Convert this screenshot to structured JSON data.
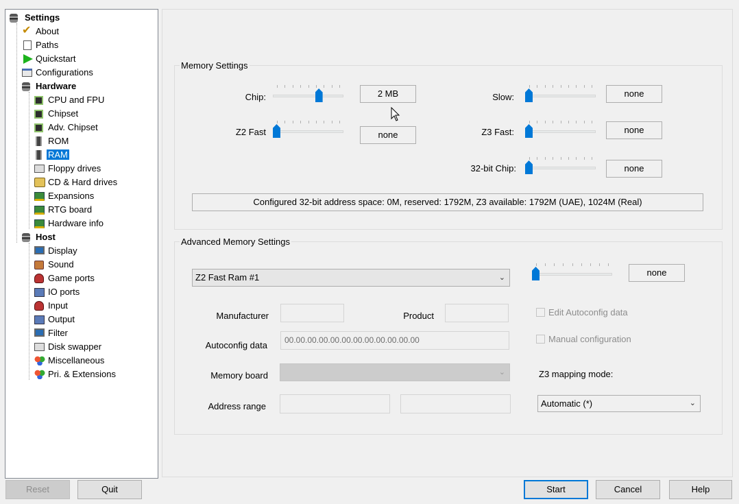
{
  "tree": {
    "settings": "Settings",
    "items": [
      {
        "label": "About",
        "icon": "checkmark-icon"
      },
      {
        "label": "Paths",
        "icon": "document-icon"
      },
      {
        "label": "Quickstart",
        "icon": "play-icon"
      },
      {
        "label": "Configurations",
        "icon": "configuration-icon"
      }
    ],
    "hardware": "Hardware",
    "hardware_items": [
      {
        "label": "CPU and FPU",
        "icon": "cpu-chip-icon"
      },
      {
        "label": "Chipset",
        "icon": "chip-icon"
      },
      {
        "label": "Adv. Chipset",
        "icon": "chip-icon"
      },
      {
        "label": "ROM",
        "icon": "rom-icon"
      },
      {
        "label": "RAM",
        "icon": "ram-icon",
        "selected": true
      },
      {
        "label": "Floppy drives",
        "icon": "floppy-icon"
      },
      {
        "label": "CD & Hard drives",
        "icon": "harddrive-icon"
      },
      {
        "label": "Expansions",
        "icon": "expansion-card-icon"
      },
      {
        "label": "RTG board",
        "icon": "graphics-card-icon"
      },
      {
        "label": "Hardware info",
        "icon": "info-card-icon"
      }
    ],
    "host": "Host",
    "host_items": [
      {
        "label": "Display",
        "icon": "monitor-icon"
      },
      {
        "label": "Sound",
        "icon": "speaker-icon"
      },
      {
        "label": "Game ports",
        "icon": "joystick-icon"
      },
      {
        "label": "IO ports",
        "icon": "network-icon"
      },
      {
        "label": "Input",
        "icon": "joystick-icon"
      },
      {
        "label": "Output",
        "icon": "output-icon"
      },
      {
        "label": "Filter",
        "icon": "filter-icon"
      },
      {
        "label": "Disk swapper",
        "icon": "disk-swapper-icon"
      },
      {
        "label": "Miscellaneous",
        "icon": "balls-icon"
      },
      {
        "label": "Pri. & Extensions",
        "icon": "balls-icon"
      }
    ]
  },
  "memory": {
    "title": "Memory Settings",
    "chip": {
      "label": "Chip:",
      "value": "2 MB",
      "level": 0.67
    },
    "z2fast": {
      "label": "Z2 Fast",
      "value": "none",
      "level": 0
    },
    "slow": {
      "label": "Slow:",
      "value": "none",
      "level": 0
    },
    "z3fast": {
      "label": "Z3 Fast:",
      "value": "none",
      "level": 0
    },
    "chip32": {
      "label": "32-bit Chip:",
      "value": "none",
      "level": 0
    },
    "info": "Configured 32-bit address space: 0M, reserved: 1792M, Z3 available: 1792M (UAE), 1024M (Real)"
  },
  "advanced": {
    "title": "Advanced Memory Settings",
    "board_select": "Z2 Fast Ram #1",
    "slider_value": "none",
    "slider_level": 0,
    "manufacturer_label": "Manufacturer",
    "product_label": "Product",
    "autoconfig_label": "Autoconfig data",
    "autoconfig_value": "00.00.00.00.00.00.00.00.00.00.00.00",
    "edit_autoconfig": "Edit Autoconfig data",
    "manual_config": "Manual configuration",
    "memory_board_label": "Memory board",
    "z3_mapping_label": "Z3 mapping mode:",
    "z3_mapping_value": "Automatic (*)",
    "address_range_label": "Address range"
  },
  "buttons": {
    "reset": "Reset",
    "quit": "Quit",
    "start": "Start",
    "cancel": "Cancel",
    "help": "Help"
  },
  "colors": {
    "accent": "#0078d7",
    "background": "#f0f0f0"
  }
}
